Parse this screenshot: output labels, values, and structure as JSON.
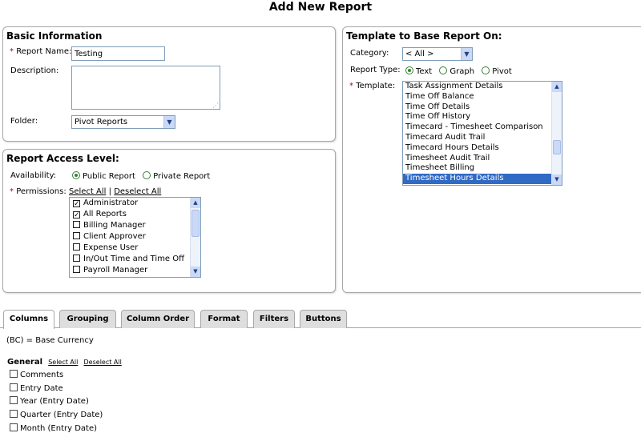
{
  "page": {
    "title": "Add New Report"
  },
  "basic_info": {
    "title": "Basic Information",
    "report_name_label": "Report Name:",
    "report_name_value": "Testing",
    "description_label": "Description:",
    "description_value": "",
    "folder_label": "Folder:",
    "folder_value": "Pivot Reports"
  },
  "access": {
    "title": "Report Access Level:",
    "availability_label": "Availability:",
    "public_label": "Public Report",
    "private_label": "Private Report",
    "availability_selected": "public",
    "permissions_label": "Permissions:",
    "select_all": "Select All",
    "separator": "|",
    "deselect_all": "Deselect All",
    "permissions": [
      {
        "label": "Administrator",
        "checked": true
      },
      {
        "label": "All Reports",
        "checked": true
      },
      {
        "label": "Billing Manager",
        "checked": false
      },
      {
        "label": "Client Approver",
        "checked": false
      },
      {
        "label": "Expense User",
        "checked": false
      },
      {
        "label": "In/Out Time and Time Off",
        "checked": false
      },
      {
        "label": "Payroll Manager",
        "checked": false
      }
    ]
  },
  "template": {
    "title": "Template to Base Report On:",
    "category_label": "Category:",
    "category_value": "< All >",
    "report_type_label": "Report Type:",
    "type_text": "Text",
    "type_graph": "Graph",
    "type_pivot": "Pivot",
    "type_selected": "text",
    "template_label": "Template:",
    "items": [
      "Task Assignment Details",
      "Time Off Balance",
      "Time Off Details",
      "Time Off History",
      "Timecard - Timesheet Comparison",
      "Timecard Audit Trail",
      "Timecard Hours Details",
      "Timesheet Audit Trail",
      "Timesheet Billing",
      "Timesheet Hours Details"
    ],
    "selected_item": "Timesheet Hours Details"
  },
  "tabs": {
    "items": [
      {
        "label": "Columns",
        "active": true
      },
      {
        "label": "Grouping",
        "active": false
      },
      {
        "label": "Column Order",
        "active": false
      },
      {
        "label": "Format",
        "active": false
      },
      {
        "label": "Filters",
        "active": false
      },
      {
        "label": "Buttons",
        "active": false
      }
    ]
  },
  "columns": {
    "note": "(BC) = Base Currency",
    "section_title": "General",
    "select_all": "Select All",
    "deselect_all": "Deselect All",
    "items": [
      "Comments",
      "Entry Date",
      "Year (Entry Date)",
      "Quarter (Entry Date)",
      "Month (Entry Date)"
    ]
  },
  "icons": {
    "required": "*",
    "dropdown_arrow": "chevron-down-icon",
    "check": "check-icon",
    "grip": "resize-grip-icon"
  },
  "colors": {
    "required": "#c00000",
    "selection": "#316ac5",
    "panel_border": "#a8a8a8",
    "input_border": "#7f9db9",
    "radio_on": "#2c8a2c"
  }
}
